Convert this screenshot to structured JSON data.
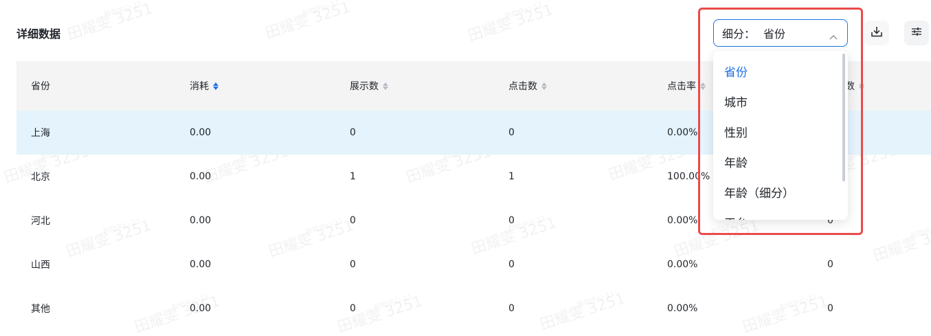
{
  "page": {
    "title": "详细数据"
  },
  "breakdown_select": {
    "prefix": "细分：",
    "value": "省份",
    "options": [
      "省份",
      "城市",
      "性别",
      "年龄",
      "年龄（细分）",
      "平台"
    ],
    "selected_index": 0
  },
  "table": {
    "headers": [
      "省份",
      "消耗",
      "展示数",
      "点击数",
      "点击率",
      "数"
    ],
    "rows": [
      [
        "上海",
        "0.00",
        "0",
        "0",
        "0.00%",
        ""
      ],
      [
        "北京",
        "0.00",
        "1",
        "1",
        "100.00%",
        ""
      ],
      [
        "河北",
        "0.00",
        "0",
        "0",
        "0.00%",
        "0"
      ],
      [
        "山西",
        "0.00",
        "0",
        "0",
        "0.00%",
        "0"
      ],
      [
        "其他",
        "0.00",
        "0",
        "0",
        "0.00%",
        "0"
      ]
    ],
    "highlight_row": 0
  },
  "icons": {
    "download": "download-icon",
    "settings": "sliders-icon",
    "chevron": "chevron-up-icon"
  },
  "colors": {
    "accent": "#1f6fe5",
    "annotation": "#ea4a4a",
    "row_highlight": "#e4f3fc",
    "header_bg": "#f4f4f5"
  },
  "watermark": {
    "name": "田耀雯 3251",
    "sub": "帮助中心-11"
  }
}
